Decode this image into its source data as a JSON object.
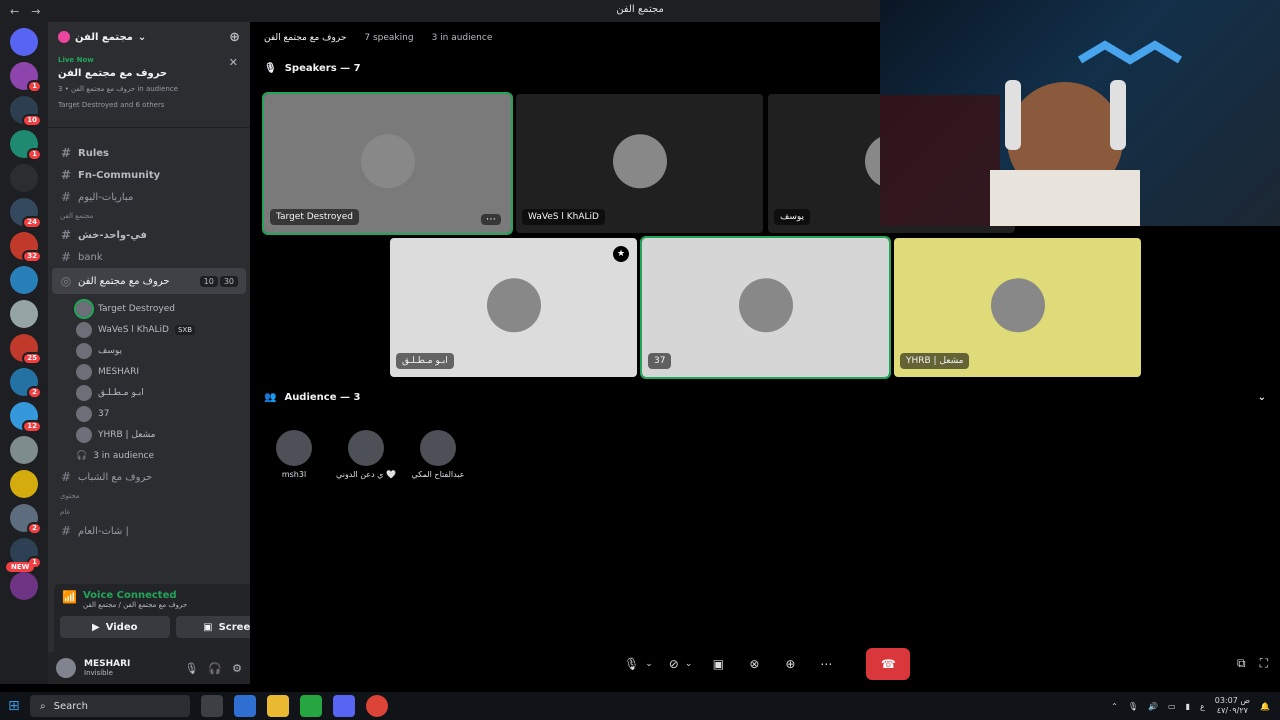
{
  "window": {
    "title": "مجتمع الفن"
  },
  "guilds": {
    "items": [
      {
        "icon": "discord-home-icon",
        "color": "#5865f2",
        "badge": ""
      },
      {
        "icon": "server-icon",
        "color": "#8e44ad",
        "badge": "1"
      },
      {
        "icon": "server-icon",
        "color": "#2c3e50",
        "badge": "10"
      },
      {
        "icon": "server-icon",
        "color": "#1f8a70",
        "badge": "1"
      },
      {
        "icon": "pin-icon",
        "color": "#2b2d31",
        "badge": ""
      },
      {
        "icon": "server-icon",
        "color": "#34495e",
        "badge": "24"
      },
      {
        "icon": "server-icon",
        "color": "#c0392b",
        "badge": "32"
      },
      {
        "icon": "server-icon",
        "color": "#2980b9",
        "badge": ""
      },
      {
        "icon": "server-icon",
        "color": "#95a5a6",
        "badge": ""
      },
      {
        "icon": "server-icon",
        "color": "#c0392b",
        "badge": "25"
      },
      {
        "icon": "server-icon",
        "color": "#2471a3",
        "badge": "2"
      },
      {
        "icon": "server-icon",
        "color": "#3498db",
        "badge": "12"
      },
      {
        "icon": "server-icon",
        "color": "#7f8c8d",
        "badge": ""
      },
      {
        "icon": "server-icon",
        "color": "#d4ac0d",
        "badge": ""
      },
      {
        "icon": "server-icon",
        "color": "#5d6d7e",
        "badge": "2"
      },
      {
        "icon": "server-icon",
        "color": "#2e4053",
        "badge": "1"
      },
      {
        "icon": "server-icon",
        "color": "#6c3483",
        "badge": ""
      }
    ],
    "new_label": "NEW"
  },
  "server": {
    "name": "مجتمع الفن"
  },
  "live": {
    "status": "Live Now",
    "title": "حروف مع مجتمع الفن",
    "sub": "حروف مع مجتمع الفن • 3 in audience",
    "others": "Target Destroyed and 6 others"
  },
  "channels": [
    {
      "type": "text",
      "label": "Rules",
      "bold": true
    },
    {
      "type": "text",
      "label": "Fn-Community",
      "bold": true
    },
    {
      "type": "text",
      "label": "مباريات-اليوم",
      "bold": false
    }
  ],
  "category1": "مجتمع الفن",
  "channels2": [
    {
      "type": "text",
      "label": "في-واحد-خش",
      "bold": true
    },
    {
      "type": "text",
      "label": "bank",
      "bold": false
    }
  ],
  "stage_channel": {
    "label": "حروف مع مجتمع الفن",
    "sub": "حروف مع مجتمع الفن",
    "speak_count": "10",
    "aud_count": "30"
  },
  "voice_users": [
    {
      "name": "Target Destroyed",
      "speaking": true,
      "tag": ""
    },
    {
      "name": "WaVeS l KhALiD",
      "speaking": false,
      "tag": "SXB"
    },
    {
      "name": "يوسف",
      "speaking": false,
      "tag": ""
    },
    {
      "name": "MESHARI",
      "speaking": false,
      "tag": ""
    },
    {
      "name": "ابـو مـطـلـق",
      "speaking": false,
      "tag": ""
    },
    {
      "name": "37",
      "speaking": false,
      "tag": ""
    },
    {
      "name": "YHRB | مشعل",
      "speaking": false,
      "tag": ""
    }
  ],
  "in_audience": "3 in audience",
  "channels3": [
    {
      "label": "حروف مع الشباب"
    }
  ],
  "category2": "محتوى",
  "category3": "عام",
  "channels4": [
    {
      "label": "شات-العام |"
    }
  ],
  "voice": {
    "status": "Voice Connected",
    "sub": "حروف مع مجتمع الفن / مجتمع الفن",
    "video": "Video",
    "screen": "Screen"
  },
  "user": {
    "name": "MESHARI",
    "status": "Invisible"
  },
  "stage": {
    "title": "حروف مع مجتمع الفن",
    "speaking": "7 speaking",
    "audience": "3 in audience",
    "speakers_label": "Speakers — 7",
    "audience_label": "Audience — 3"
  },
  "speakers": [
    {
      "name": "Target Destroyed",
      "bg": "#7a7a7a",
      "speaking": true
    },
    {
      "name": "WaVeS l KhALiD",
      "bg": "#202020",
      "speaking": false
    },
    {
      "name": "يوسف",
      "bg": "#202020",
      "speaking": false
    },
    {
      "name": "ابـو مـطـلـق",
      "bg": "#dcdcdc",
      "speaking": false
    },
    {
      "name": "37",
      "bg": "#d6d6d6",
      "speaking": true
    },
    {
      "name": "YHRB | مشعل",
      "bg": "#dedb78",
      "speaking": false
    }
  ],
  "audience": [
    {
      "name": "msh3l"
    },
    {
      "name": "ي دعن الدوني 🤍"
    },
    {
      "name": "عبدالفتاح المكي"
    }
  ],
  "taskbar": {
    "search": "Search",
    "time": "03:07 ص",
    "date": "٤٧/٠٩/٢٧",
    "lang": "ع"
  }
}
